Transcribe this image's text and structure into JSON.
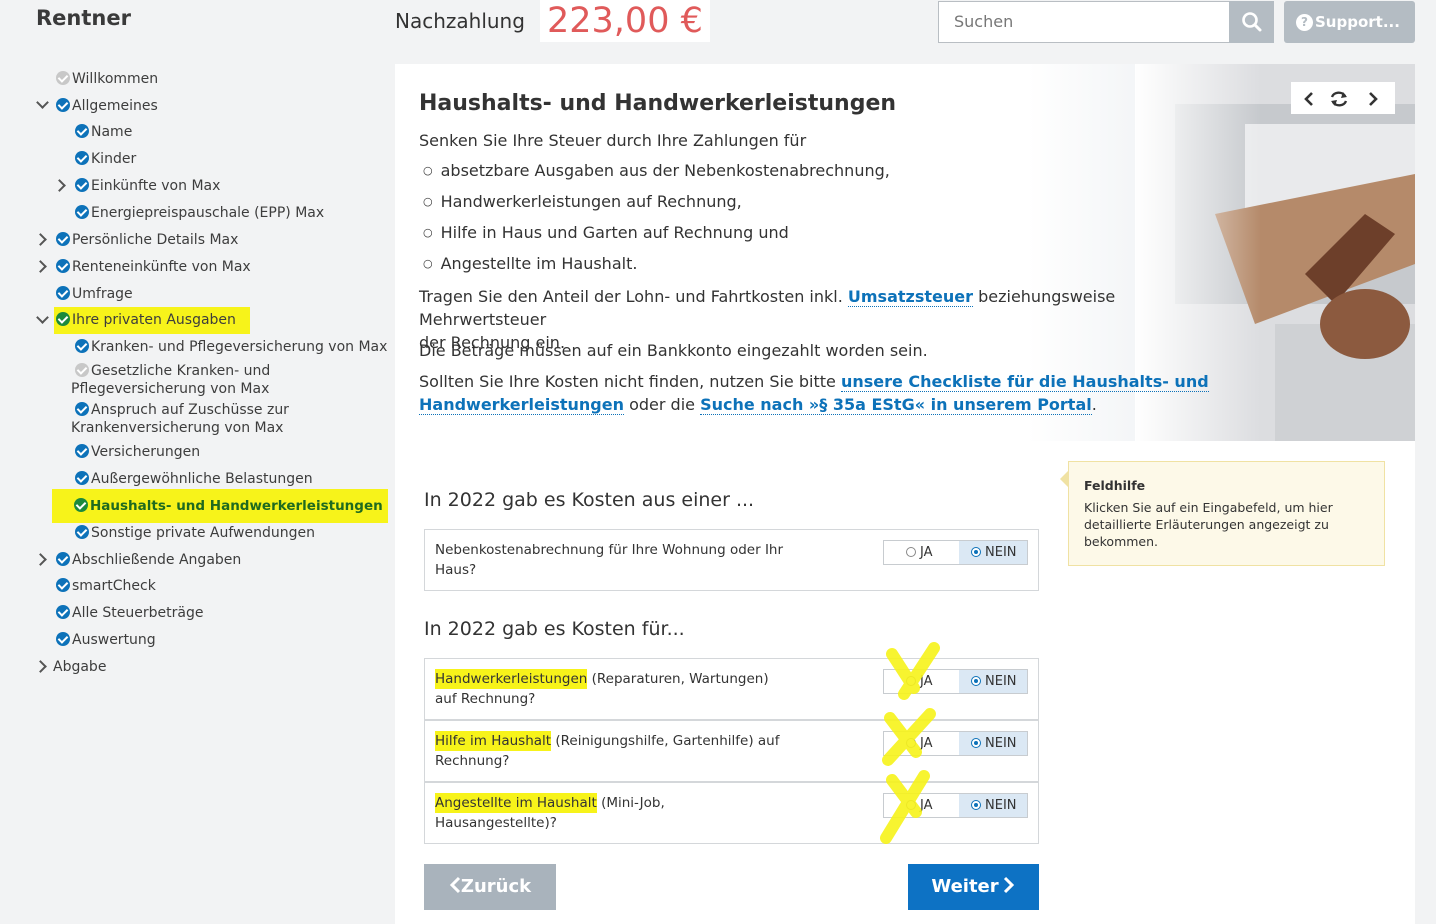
{
  "app_title": "Rentner",
  "refund": {
    "label": "Nachzahlung",
    "value": "223,00 €"
  },
  "search": {
    "placeholder": "Suchen"
  },
  "support_label": "Support...",
  "sidebar": {
    "items": [
      {
        "label": "Willkommen"
      },
      {
        "label": "Allgemeines"
      },
      {
        "label": "Name"
      },
      {
        "label": "Kinder"
      },
      {
        "label": "Einkünfte von Max"
      },
      {
        "label": "Energiepreispauschale (EPP) Max"
      },
      {
        "label": "Persönliche Details Max"
      },
      {
        "label": "Renteneinkünfte von Max"
      },
      {
        "label": "Umfrage"
      },
      {
        "label": "Ihre privaten Ausgaben"
      },
      {
        "label": "Kranken- und Pflegeversicherung von Max"
      },
      {
        "label_line1": "Gesetzliche Kranken- und",
        "label_line2": "Pflegeversicherung von Max"
      },
      {
        "label_line1": "Anspruch auf Zuschüsse zur",
        "label_line2": "Krankenversicherung von Max"
      },
      {
        "label": "Versicherungen"
      },
      {
        "label": "Außergewöhnliche Belastungen"
      },
      {
        "label": "Haushalts- und Handwerkerleistungen"
      },
      {
        "label": "Sonstige private Aufwendungen"
      },
      {
        "label": "Abschließende Angaben"
      },
      {
        "label": "smartCheck"
      },
      {
        "label": "Alle Steuerbeträge"
      },
      {
        "label": "Auswertung"
      },
      {
        "label": "Abgabe"
      }
    ]
  },
  "main": {
    "title": "Haushalts- und Handwerkerleistungen",
    "intro": "Senken Sie Ihre Steuer durch Ihre Zahlungen für",
    "bullets": [
      "absetzbare Ausgaben aus der Nebenkostenabrechnung,",
      "Handwerkerleistungen auf Rechnung,",
      "Hilfe in Haus und Garten auf Rechnung und",
      "Angestellte im Haushalt."
    ],
    "para1_a": "Tragen Sie den Anteil der Lohn- und Fahrtkosten inkl.",
    "para1_link": "Umsatzsteuer",
    "para1_b": "beziehungsweise Mehrwertsteuer",
    "para1_c": "der Rechnung ein.",
    "para2": "Die Beträge müssen auf ein Bankkonto eingezahlt worden sein.",
    "para3_a": "Sollten Sie Ihre Kosten nicht finden, nutzen Sie bitte",
    "para3_link1a": "unsere Checkliste für die Haushalts- und",
    "para3_link1b": "Handwerkerleistungen",
    "para3_b": "oder die",
    "para3_link2": "Suche nach »§ 35a EStG« in unserem Portal",
    "para3_c": "."
  },
  "section1": {
    "title": "In 2022 gab es Kosten aus einer ...",
    "questions": [
      {
        "line1": "Nebenkostenabrechnung für Ihre Wohnung oder Ihr",
        "line2": "Haus?",
        "ja": "JA",
        "nein": "NEIN",
        "selected": "NEIN"
      }
    ]
  },
  "section2": {
    "title": "In 2022 gab es Kosten für...",
    "questions": [
      {
        "hl": "Handwerkerleistungen",
        "rest": " (Reparaturen, Wartungen)",
        "line2": "auf Rechnung?",
        "ja": "JA",
        "nein": "NEIN",
        "selected": "NEIN"
      },
      {
        "hl": "Hilfe im Haushalt",
        "rest": " (Reinigungshilfe, Gartenhilfe) auf",
        "line2": "Rechnung?",
        "ja": "JA",
        "nein": "NEIN",
        "selected": "NEIN"
      },
      {
        "hl": "Angestellte im Haushalt",
        "rest": " (Mini-Job,",
        "line2": "Hausangestellte)?",
        "ja": "JA",
        "nein": "NEIN",
        "selected": "NEIN"
      }
    ]
  },
  "help": {
    "title": "Feldhilfe",
    "text": "Klicken Sie auf ein Eingabefeld, um hier detaillierte Erläuterungen angezeigt zu bekommen."
  },
  "buttons": {
    "back": "Zurück",
    "next": "Weiter"
  },
  "colors": {
    "brand_blue": "#0d72b9",
    "refund_red": "#e05a5a",
    "highlight": "#f7f31a"
  }
}
